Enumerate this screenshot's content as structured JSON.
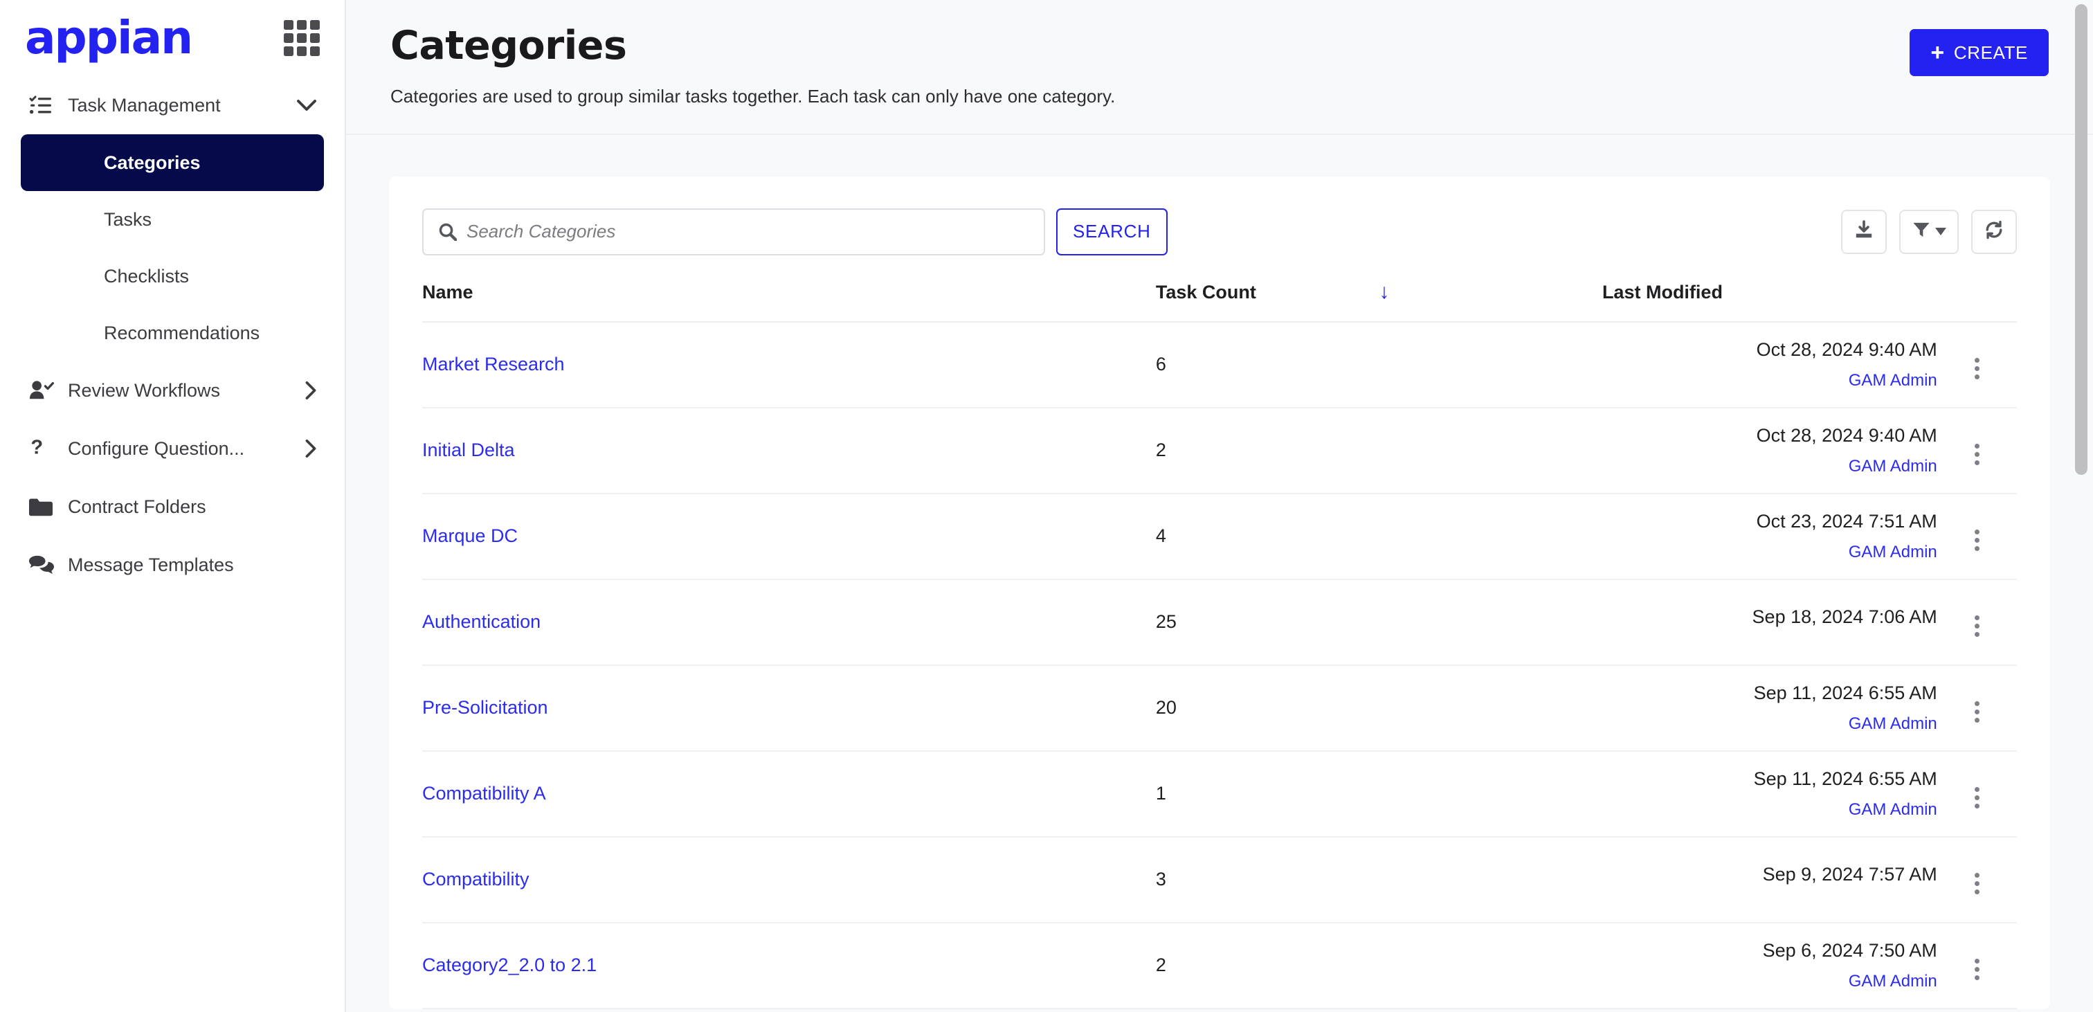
{
  "brand": {
    "logo_text": "appian",
    "logo_color": "#2322f0",
    "apps_icon": "grid-apps-icon"
  },
  "sidebar": {
    "group": {
      "label": "Task Management",
      "icon": "checklist-icon",
      "chevron": "chevron-down-icon"
    },
    "sub_items": [
      {
        "label": "Categories",
        "active": true
      },
      {
        "label": "Tasks",
        "active": false
      },
      {
        "label": "Checklists",
        "active": false
      },
      {
        "label": "Recommendations",
        "active": false
      }
    ],
    "nav_items": [
      {
        "label": "Review Workflows",
        "icon": "user-check-icon",
        "chevron": "chevron-right-icon"
      },
      {
        "label": "Configure Question...",
        "icon": "question-mark-icon",
        "chevron": "chevron-right-icon"
      },
      {
        "label": "Contract Folders",
        "icon": "folder-icon",
        "chevron": ""
      },
      {
        "label": "Message Templates",
        "icon": "chat-bubbles-icon",
        "chevron": ""
      }
    ],
    "active_color": "#050a4b"
  },
  "header": {
    "title": "Categories",
    "subtitle": "Categories are used to group similar tasks together. Each task can only have one category.",
    "create_label": "CREATE",
    "create_plus": "+",
    "create_color": "#2322f0"
  },
  "toolbar": {
    "search_placeholder": "Search Categories",
    "search_value": "",
    "search_icon": "magnifier-icon",
    "search_button": "SEARCH",
    "buttons": [
      {
        "name": "export-download-button",
        "icon": "download-icon"
      },
      {
        "name": "filter-button",
        "icon": "filter-funnel-icon"
      },
      {
        "name": "refresh-button",
        "icon": "refresh-icon"
      }
    ]
  },
  "table": {
    "columns": {
      "name": "Name",
      "task_count": "Task Count",
      "last_modified": "Last Modified"
    },
    "sort": {
      "column": "task_count",
      "direction": "desc",
      "glyph": "↓",
      "color": "#2322f0"
    },
    "rows": [
      {
        "name": "Market Research",
        "task_count": "6",
        "modified": "Oct 28, 2024 9:40 AM",
        "user": "GAM Admin"
      },
      {
        "name": "Initial Delta",
        "task_count": "2",
        "modified": "Oct 28, 2024 9:40 AM",
        "user": "GAM Admin"
      },
      {
        "name": "Marque DC",
        "task_count": "4",
        "modified": "Oct 23, 2024 7:51 AM",
        "user": "GAM Admin"
      },
      {
        "name": "Authentication",
        "task_count": "25",
        "modified": "Sep 18, 2024 7:06 AM",
        "user": ""
      },
      {
        "name": "Pre-Solicitation",
        "task_count": "20",
        "modified": "Sep 11, 2024 6:55 AM",
        "user": "GAM Admin"
      },
      {
        "name": "Compatibility A",
        "task_count": "1",
        "modified": "Sep 11, 2024 6:55 AM",
        "user": "GAM Admin"
      },
      {
        "name": "Compatibility",
        "task_count": "3",
        "modified": "Sep 9, 2024 7:57 AM",
        "user": ""
      },
      {
        "name": "Category2_2.0 to 2.1",
        "task_count": "2",
        "modified": "Sep 6, 2024 7:50 AM",
        "user": "GAM Admin"
      }
    ],
    "row_menu_icon": "kebab-menu-icon"
  }
}
